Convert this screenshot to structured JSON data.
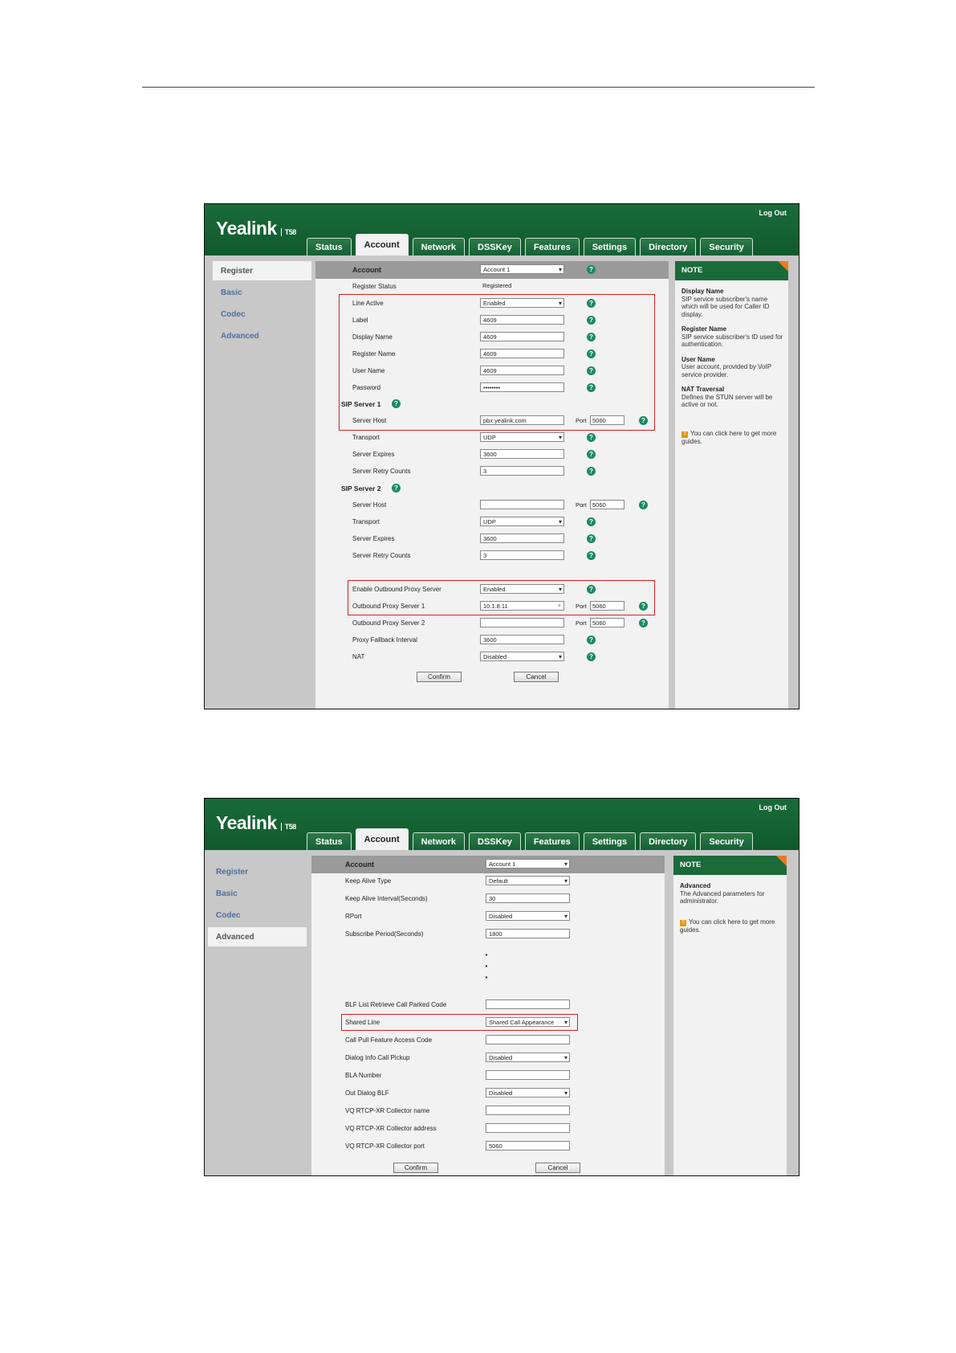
{
  "screenshot1": {
    "logout": "Log Out",
    "logo": {
      "brand": "Yealink",
      "model": "T58"
    },
    "tabs": [
      "Status",
      "Account",
      "Network",
      "DSSKey",
      "Features",
      "Settings",
      "Directory",
      "Security"
    ],
    "active_tab": "Account",
    "sidebar": [
      "Register",
      "Basic",
      "Codec",
      "Advanced"
    ],
    "active_sidebar": "Register",
    "account_label": "Account",
    "account_value": "Account 1",
    "register_status_label": "Register Status",
    "register_status_value": "Registered",
    "rows": {
      "line_active": {
        "label": "Line Active",
        "value": "Enabled"
      },
      "label": {
        "label": "Label",
        "value": "4609"
      },
      "display_name": {
        "label": "Display Name",
        "value": "4609"
      },
      "register_name": {
        "label": "Register Name",
        "value": "4609"
      },
      "user_name": {
        "label": "User Name",
        "value": "4609"
      },
      "password": {
        "label": "Password",
        "value": "••••••••"
      },
      "sip1": {
        "label": "SIP Server 1"
      },
      "server_host1": {
        "label": "Server Host",
        "value": "pbx.yealink.com",
        "port_label": "Port",
        "port": "5060"
      },
      "transport1": {
        "label": "Transport",
        "value": "UDP"
      },
      "server_expires1": {
        "label": "Server Expires",
        "value": "3600"
      },
      "server_retry1": {
        "label": "Server Retry Counts",
        "value": "3"
      },
      "sip2": {
        "label": "SIP Server 2"
      },
      "server_host2": {
        "label": "Server Host",
        "value": "",
        "port_label": "Port",
        "port": "5060"
      },
      "transport2": {
        "label": "Transport",
        "value": "UDP"
      },
      "server_expires2": {
        "label": "Server Expires",
        "value": "3600"
      },
      "server_retry2": {
        "label": "Server Retry Counts",
        "value": "3"
      },
      "enable_outbound": {
        "label": "Enable Outbound Proxy Server",
        "value": "Enabled"
      },
      "outbound1": {
        "label": "Outbound Proxy Server 1",
        "value": "10.1.8.11",
        "port_label": "Port",
        "port": "5060"
      },
      "outbound2": {
        "label": "Outbound Proxy Server 2",
        "value": "",
        "port_label": "Port",
        "port": "5060"
      },
      "proxy_fallback": {
        "label": "Proxy Fallback Interval",
        "value": "3600"
      },
      "nat": {
        "label": "NAT",
        "value": "Disabled"
      }
    },
    "confirm": "Confirm",
    "cancel": "Cancel",
    "note": {
      "title": "NOTE",
      "items": [
        {
          "title": "Display Name",
          "text": "SIP service subscriber's name which will be used for Caller ID display."
        },
        {
          "title": "Register Name",
          "text": "SIP service subscriber's ID used for authentication."
        },
        {
          "title": "User Name",
          "text": "User account, provided by VoIP service provider."
        },
        {
          "title": "NAT Traversal",
          "text": "Defines the STUN server will be active or not."
        }
      ],
      "guide": "You can click here to get more guides."
    }
  },
  "screenshot2": {
    "logout": "Log Out",
    "logo": {
      "brand": "Yealink",
      "model": "T58"
    },
    "tabs": [
      "Status",
      "Account",
      "Network",
      "DSSKey",
      "Features",
      "Settings",
      "Directory",
      "Security"
    ],
    "active_tab": "Account",
    "sidebar": [
      "Register",
      "Basic",
      "Codec",
      "Advanced"
    ],
    "active_sidebar": "Advanced",
    "account_label": "Account",
    "account_value": "Account 1",
    "rows": {
      "keep_alive_type": {
        "label": "Keep Alive Type",
        "value": "Default"
      },
      "keep_alive_interval": {
        "label": "Keep Alive Interval(Seconds)",
        "value": "30"
      },
      "rport": {
        "label": "RPort",
        "value": "Disabled"
      },
      "subscribe_period": {
        "label": "Subscribe Period(Seconds)",
        "value": "1800"
      },
      "blf_list_retrieve": {
        "label": "BLF List Retrieve Call Parked Code",
        "value": ""
      },
      "shared_line": {
        "label": "Shared Line",
        "value": "Shared Call Appearance"
      },
      "call_pull": {
        "label": "Call Pull Feature Access Code",
        "value": ""
      },
      "dialog_info": {
        "label": "Dialog Info Call Pickup",
        "value": "Disabled"
      },
      "bla_number": {
        "label": "BLA Number",
        "value": ""
      },
      "out_dialog_blf": {
        "label": "Out Dialog BLF",
        "value": "Disabled"
      },
      "vq_name": {
        "label": "VQ RTCP-XR Collector name",
        "value": ""
      },
      "vq_address": {
        "label": "VQ RTCP-XR Collector address",
        "value": ""
      },
      "vq_port": {
        "label": "VQ RTCP-XR Collector port",
        "value": "5060"
      }
    },
    "confirm": "Confirm",
    "cancel": "Cancel",
    "note": {
      "title": "NOTE",
      "items": [
        {
          "title": "Advanced",
          "text": "The Advanced parameters for administrator."
        }
      ],
      "guide": "You can click here to get more guides."
    }
  }
}
